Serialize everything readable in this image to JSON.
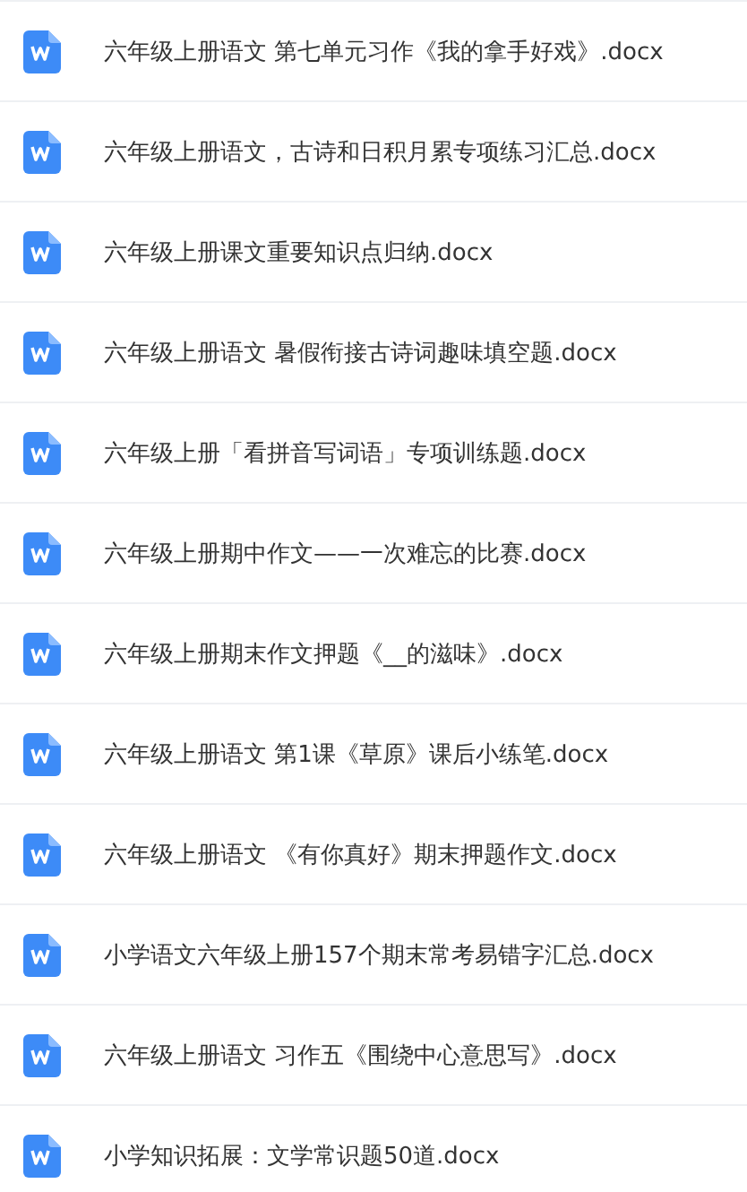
{
  "files": [
    {
      "name": "六年级上册语文 第七单元习作《我的拿手好戏》.docx"
    },
    {
      "name": "六年级上册语文，古诗和日积月累专项练习汇总.docx"
    },
    {
      "name": "六年级上册课文重要知识点归纳.docx"
    },
    {
      "name": "六年级上册语文 暑假衔接古诗词趣味填空题.docx"
    },
    {
      "name": "六年级上册「看拼音写词语」专项训练题.docx"
    },
    {
      "name": "六年级上册期中作文——一次难忘的比赛.docx"
    },
    {
      "name": "六年级上册期末作文押题《__的滋味》.docx"
    },
    {
      "name": "六年级上册语文 第1课《草原》课后小练笔.docx"
    },
    {
      "name": "六年级上册语文 《有你真好》期末押题作文.docx"
    },
    {
      "name": "小学语文六年级上册157个期末常考易错字汇总.docx"
    },
    {
      "name": "六年级上册语文 习作五《围绕中心意思写》.docx"
    },
    {
      "name": "小学知识拓展：文学常识题50道.docx"
    }
  ]
}
